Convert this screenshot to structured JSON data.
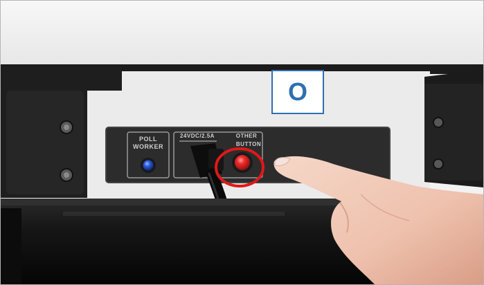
{
  "photo": {
    "callout_letter": "O",
    "labels": {
      "poll_worker_line1": "POLL",
      "poll_worker_line2": "WORKER",
      "power": "24VDC/2.5A",
      "other_line1": "OTHER",
      "other_line2": "BUTTON"
    },
    "colors": {
      "callout_border": "#2f6fb0",
      "highlight_ring": "#e01818",
      "red_button": "#e02a2a",
      "blue_button": "#2a5ad8"
    }
  }
}
